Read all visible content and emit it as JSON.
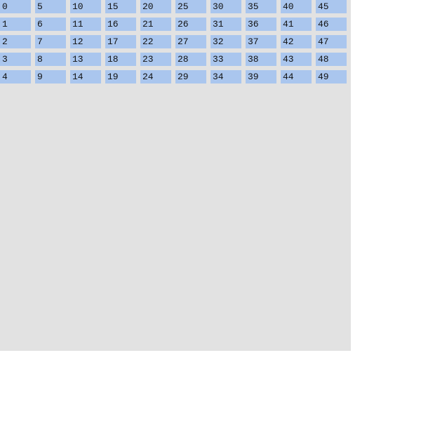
{
  "colors": {
    "panel_background": "#e2e2e2",
    "cell_background": "#aac6ee",
    "cell_text": "#111111",
    "page_background": "#ffffff"
  },
  "grid": {
    "rows": [
      [
        "0",
        "5",
        "10",
        "15",
        "20",
        "25",
        "30",
        "35",
        "40",
        "45"
      ],
      [
        "1",
        "6",
        "11",
        "16",
        "21",
        "26",
        "31",
        "36",
        "41",
        "46"
      ],
      [
        "2",
        "7",
        "12",
        "17",
        "22",
        "27",
        "32",
        "37",
        "42",
        "47"
      ],
      [
        "3",
        "8",
        "13",
        "18",
        "23",
        "28",
        "33",
        "38",
        "43",
        "48"
      ],
      [
        "4",
        "9",
        "14",
        "19",
        "24",
        "29",
        "34",
        "39",
        "44",
        "49"
      ]
    ]
  }
}
